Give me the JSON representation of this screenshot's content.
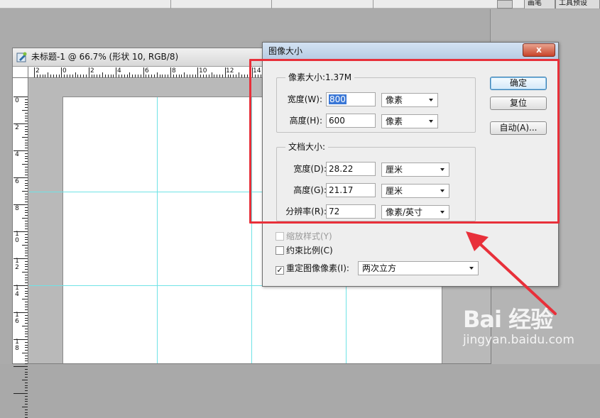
{
  "top_tabs": [
    "画笔",
    "工具预设"
  ],
  "document": {
    "title": "未标题-1 @ 66.7% (形状 10, RGB/8)",
    "ruler_h_labels": [
      "2",
      "0",
      "2",
      "4",
      "6",
      "8",
      "10",
      "12",
      "14"
    ],
    "ruler_v_labels": [
      "0",
      "2",
      "4",
      "6",
      "8",
      "1\n0",
      "1\n2",
      "1\n4",
      "1\n6",
      "1\n8"
    ]
  },
  "dialog": {
    "title": "图像大小",
    "close_label": "x",
    "pixel_group": {
      "legend": "像素大小:1.37M",
      "width_label": "宽度(W):",
      "width_value": "800",
      "width_unit": "像素",
      "height_label": "高度(H):",
      "height_value": "600",
      "height_unit": "像素"
    },
    "doc_group": {
      "legend": "文档大小:",
      "width_label": "宽度(D):",
      "width_value": "28.22",
      "width_unit": "厘米",
      "height_label": "高度(G):",
      "height_value": "21.17",
      "height_unit": "厘米",
      "res_label": "分辨率(R):",
      "res_value": "72",
      "res_unit": "像素/英寸"
    },
    "buttons": {
      "ok": "确定",
      "reset": "复位",
      "auto": "自动(A)..."
    },
    "checks": {
      "scale_styles": "缩放样式(Y)",
      "constrain": "约束比例(C)",
      "resample": "重定图像像素(I):",
      "resample_checked": true,
      "resample_method": "两次立方"
    }
  },
  "watermark": {
    "main": "Bai 经验",
    "sub": "jingyan.baidu.com"
  },
  "colors": {
    "highlight": "#e8303a",
    "guide": "#6fe3e6"
  }
}
